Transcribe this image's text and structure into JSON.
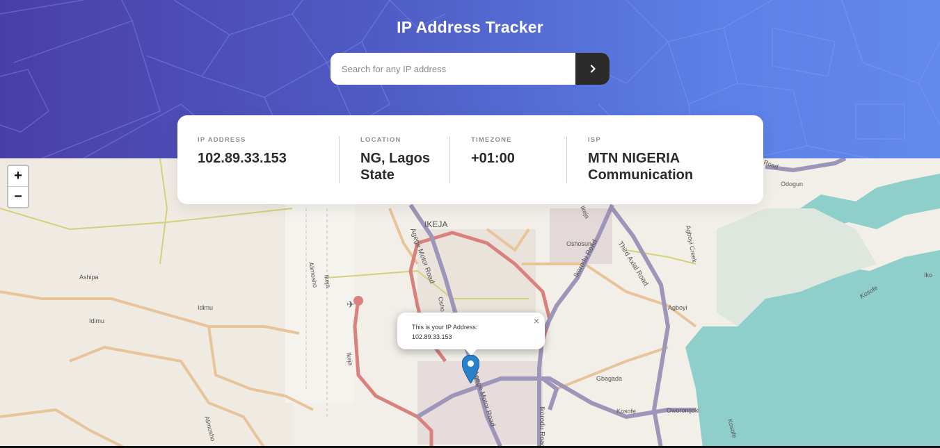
{
  "header": {
    "title": "IP Address Tracker",
    "search_placeholder": "Search for any IP address",
    "submit_icon": "chevron-right-icon"
  },
  "info": {
    "ip_label": "IP ADDRESS",
    "ip_value": "102.89.33.153",
    "location_label": "LOCATION",
    "location_line1": "NG, Lagos",
    "location_line2": "State",
    "timezone_label": "TIMEZONE",
    "timezone_value": "+01:00",
    "isp_label": "ISP",
    "isp_line1": "MTN NIGERIA",
    "isp_line2": "Communication"
  },
  "map": {
    "zoom_in": "+",
    "zoom_out": "−",
    "popup_line1": "This is your IP Address:",
    "popup_line2": "102.89.33.153",
    "popup_close": "×",
    "labels": {
      "ikeja": "IKEJA",
      "agege_motor_road_1": "Agege Motor Road",
      "agege_motor_road_2": "Agege Motor Road",
      "ikorodu_road_1": "Ikorodu Road",
      "ikorodu_road_2": "Ikorodu Road",
      "third_axial_road": "Third Axial Road",
      "oshosun": "Oshosun",
      "agboyi": "Agboyi",
      "agboyi_creek": "Agboyi Creek",
      "odogun": "Odogun",
      "ashipa": "Ashipa",
      "idimu_1": "Idimu",
      "idimu_2": "Idimu",
      "alimosho_1": "Alimosho",
      "alimosho_2": "Alimosho",
      "ikeja_1": "Ikeja",
      "ikeja_2": "Ikeja",
      "gbagada": "Gbagada",
      "kosofe_1": "Kosofe",
      "kosofe_2": "Kosofe",
      "kosofe_3": "Kosofe",
      "oworonsoki": "Oworonşoki",
      "ikorodu_partial": "Iko",
      "road_partial": "Road",
      "osho_partial": "Osho",
      "ikeja_partial": "Ikeja"
    },
    "colors": {
      "land": "#f2efe9",
      "water": "#8ecfcb",
      "motorway": "#9e96b8",
      "primary": "#d9827d",
      "secondary": "#e8c49a",
      "tertiary": "#d4d07a",
      "marker": "#2a81cb"
    }
  }
}
